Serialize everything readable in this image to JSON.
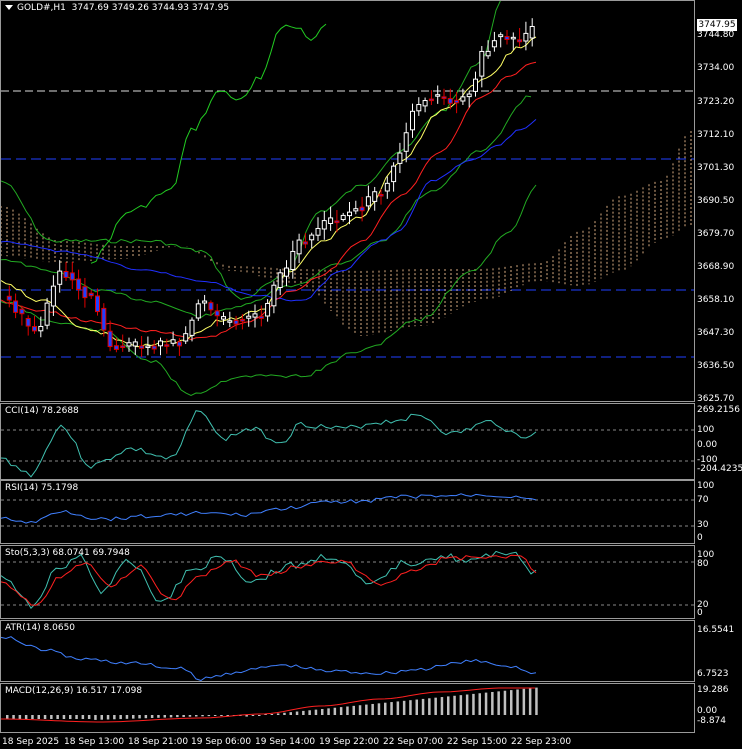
{
  "main": {
    "symbol": "GOLD#,H1",
    "ohlc": "3747.69 3749.26 3744.93 3747.95",
    "current_price": "3747.95",
    "price_labels": [
      "3744.80",
      "3734.00",
      "3723.20",
      "3712.10",
      "3701.30",
      "3690.50",
      "3679.70",
      "3668.90",
      "3658.10",
      "3647.30",
      "3636.50",
      "3625.70"
    ]
  },
  "cci": {
    "title": "CCI(14) 78.2688",
    "labels": [
      "269.2156",
      "100",
      "0.00",
      "-100",
      "-204.4235"
    ]
  },
  "rsi": {
    "title": "RSI(14) 75.1798",
    "labels": [
      "100",
      "70",
      "30",
      "0"
    ]
  },
  "sto": {
    "title": "Sto(5,3,3) 68.0741 69.7948",
    "labels": [
      "100",
      "80",
      "20",
      "0"
    ]
  },
  "atr": {
    "title": "ATR(14) 8.0650",
    "labels": [
      "16.5541",
      "6.7523"
    ]
  },
  "macd": {
    "title": "MACD(12,26,9) 16.517 17.098",
    "labels": [
      "19.286",
      "0.00",
      "-8.874"
    ]
  },
  "time_labels": [
    "18 Sep 2025",
    "18 Sep 13:00",
    "18 Sep 21:00",
    "19 Sep 06:00",
    "19 Sep 14:00",
    "19 Sep 22:00",
    "22 Sep 07:00",
    "22 Sep 15:00",
    "22 Sep 23:00"
  ],
  "colors": {
    "bull_candle": "#ffffff",
    "bear_candle": "#e00000",
    "bull_fill": "#000000",
    "bear_fill": "#2040ff",
    "bb": "#22aa22",
    "ma_fast": "#ffff66",
    "ma_slow": "#ff2020",
    "ma_long": "#2030ff",
    "kumo": "#ffcc99",
    "level_line": "#2040ff",
    "cci_line": "#40c0b0",
    "rsi_line": "#4080ff",
    "sto_main": "#40c0b0",
    "sto_signal": "#ff2020",
    "atr_line": "#4080ff",
    "macd_hist": "#c0c0c0",
    "macd_signal": "#ff2020"
  }
}
